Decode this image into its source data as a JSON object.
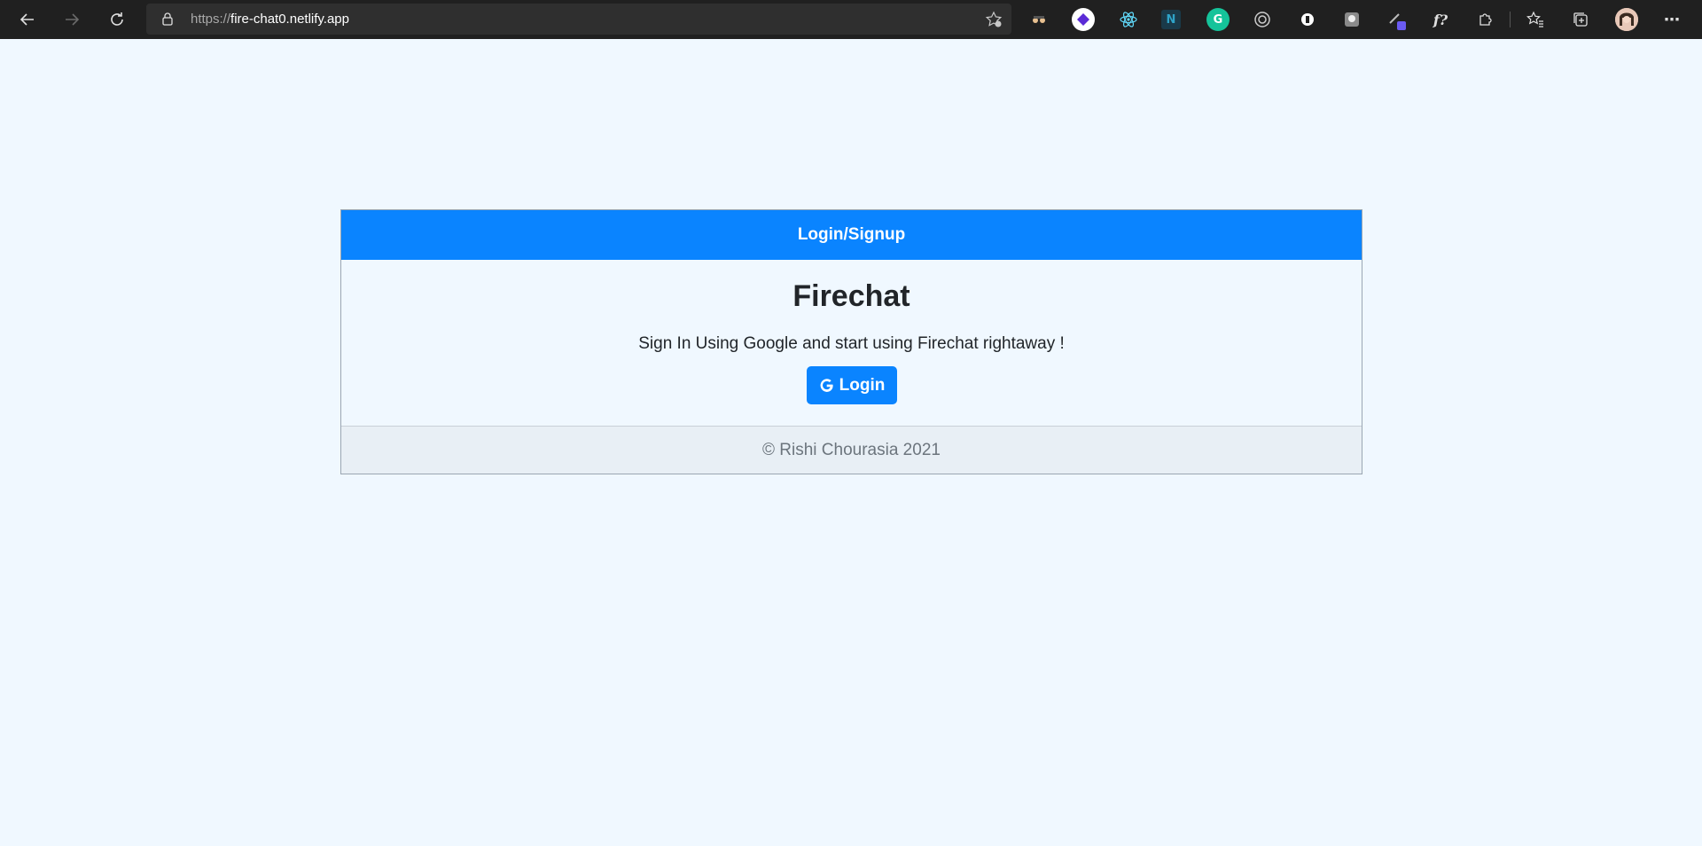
{
  "browser": {
    "url_protocol": "https://",
    "url_host": "fire-chat0.netlify.app",
    "extensions": [
      {
        "name": "spy-glasses-extension-icon",
        "color": "#202020"
      },
      {
        "name": "purple-diamond-extension-icon",
        "color": "#ffffff"
      },
      {
        "name": "react-devtools-extension-icon",
        "color": "#20232a"
      },
      {
        "name": "notion-n-extension-icon",
        "color": "#1a3a4a"
      },
      {
        "name": "grammarly-extension-icon",
        "color": "#15c39a"
      },
      {
        "name": "target-circle-extension-icon",
        "color": "#202020"
      },
      {
        "name": "white-circle-extension-icon",
        "color": "#ffffff"
      },
      {
        "name": "grey-square-extension-icon",
        "color": "#8a8a8a"
      },
      {
        "name": "pen-extension-icon",
        "color": "#202020"
      },
      {
        "name": "formula-extension-icon",
        "color": "#202020"
      }
    ]
  },
  "card": {
    "header": "Login/Signup",
    "title": "Firechat",
    "text": "Sign In Using Google and start using Firechat rightaway !",
    "login_label": "Login",
    "footer": "© Rishi Chourasia 2021"
  },
  "colors": {
    "primary": "#0a84ff",
    "page_bg": "#f0f8ff"
  }
}
